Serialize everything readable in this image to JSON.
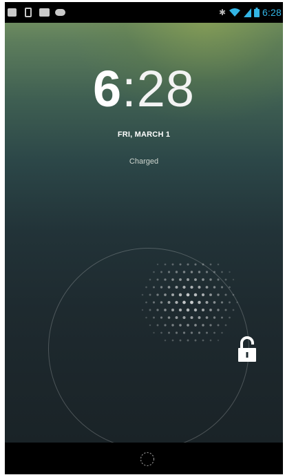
{
  "statusbar": {
    "time": "6:28",
    "notification_icons": [
      "message-icon",
      "phone-icon",
      "camera-icon",
      "chat-icon"
    ],
    "right_icons": [
      "bluetooth-icon",
      "wifi-icon",
      "signal-icon",
      "battery-icon"
    ],
    "time_color": "#33b5e5"
  },
  "lockscreen": {
    "clock_hour": "6",
    "clock_separator": ":",
    "clock_minutes": "28",
    "date": "FRI, MARCH 1",
    "status": "Charged"
  },
  "unlock": {
    "target_icon": "unlock-icon",
    "handle_icon": "dotted-ring-icon"
  }
}
